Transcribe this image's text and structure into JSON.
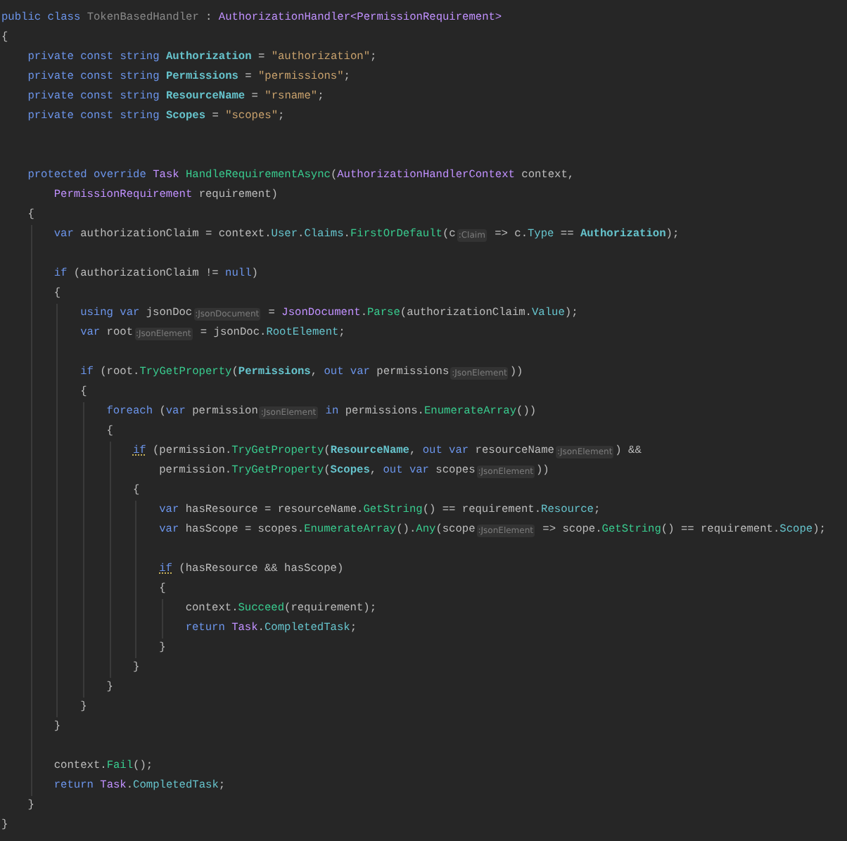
{
  "editor": {
    "lines": [
      {
        "kind": "code",
        "tokens": [
          {
            "kind": "kw",
            "text": "public class "
          },
          {
            "kind": "typedim",
            "text": "TokenBasedHandler"
          },
          {
            "kind": "plain",
            "text": " : "
          },
          {
            "kind": "type",
            "text": "AuthorizationHandler<PermissionRequirement>"
          }
        ]
      },
      {
        "kind": "code",
        "tokens": [
          {
            "kind": "plain",
            "text": "{"
          }
        ]
      },
      {
        "kind": "block",
        "guide": false,
        "children": [
          {
            "kind": "code",
            "tokens": [
              {
                "kind": "kw",
                "text": "private const string "
              },
              {
                "kind": "const",
                "text": "Authorization"
              },
              {
                "kind": "plain",
                "text": " = "
              },
              {
                "kind": "str",
                "text": "\"authorization\""
              },
              {
                "kind": "plain",
                "text": ";"
              }
            ]
          },
          {
            "kind": "code",
            "tokens": [
              {
                "kind": "kw",
                "text": "private const string "
              },
              {
                "kind": "const",
                "text": "Permissions"
              },
              {
                "kind": "plain",
                "text": " = "
              },
              {
                "kind": "str",
                "text": "\"permissions\""
              },
              {
                "kind": "plain",
                "text": ";"
              }
            ]
          },
          {
            "kind": "code",
            "tokens": [
              {
                "kind": "kw",
                "text": "private const string "
              },
              {
                "kind": "const",
                "text": "ResourceName"
              },
              {
                "kind": "plain",
                "text": " = "
              },
              {
                "kind": "str",
                "text": "\"rsname\""
              },
              {
                "kind": "plain",
                "text": ";"
              }
            ]
          },
          {
            "kind": "code",
            "tokens": [
              {
                "kind": "kw",
                "text": "private const string "
              },
              {
                "kind": "const",
                "text": "Scopes"
              },
              {
                "kind": "plain",
                "text": " = "
              },
              {
                "kind": "str",
                "text": "\"scopes\""
              },
              {
                "kind": "plain",
                "text": ";"
              }
            ]
          },
          {
            "kind": "blank"
          },
          {
            "kind": "blank"
          },
          {
            "kind": "code",
            "tokens": [
              {
                "kind": "kw",
                "text": "protected override "
              },
              {
                "kind": "type",
                "text": "Task"
              },
              {
                "kind": "method",
                "text": " HandleRequirementAsync"
              },
              {
                "kind": "plain",
                "text": "("
              },
              {
                "kind": "type",
                "text": "AuthorizationHandlerContext"
              },
              {
                "kind": "plain",
                "text": " context,"
              }
            ]
          },
          {
            "kind": "continuation",
            "tokens": [
              {
                "kind": "type",
                "text": "PermissionRequirement"
              },
              {
                "kind": "plain",
                "text": " requirement)"
              }
            ]
          },
          {
            "kind": "code",
            "tokens": [
              {
                "kind": "plain",
                "text": "{"
              }
            ]
          },
          {
            "kind": "block",
            "guide": true,
            "children": [
              {
                "kind": "code",
                "tokens": [
                  {
                    "kind": "kw",
                    "text": "var "
                  },
                  {
                    "kind": "plain",
                    "text": "authorizationClaim = context."
                  },
                  {
                    "kind": "prop",
                    "text": "User"
                  },
                  {
                    "kind": "plain",
                    "text": "."
                  },
                  {
                    "kind": "prop",
                    "text": "Claims"
                  },
                  {
                    "kind": "plain",
                    "text": "."
                  },
                  {
                    "kind": "method",
                    "text": "FirstOrDefault"
                  },
                  {
                    "kind": "plain",
                    "text": "(c"
                  },
                  {
                    "kind": "hint",
                    "text": ":Claim"
                  },
                  {
                    "kind": "plain",
                    "text": " => c."
                  },
                  {
                    "kind": "prop",
                    "text": "Type"
                  },
                  {
                    "kind": "plain",
                    "text": " == "
                  },
                  {
                    "kind": "const",
                    "text": "Authorization"
                  },
                  {
                    "kind": "plain",
                    "text": ");"
                  }
                ]
              },
              {
                "kind": "blank"
              },
              {
                "kind": "code",
                "tokens": [
                  {
                    "kind": "kw",
                    "text": "if "
                  },
                  {
                    "kind": "plain",
                    "text": "(authorizationClaim != "
                  },
                  {
                    "kind": "kw",
                    "text": "null"
                  },
                  {
                    "kind": "plain",
                    "text": ")"
                  }
                ]
              },
              {
                "kind": "code",
                "tokens": [
                  {
                    "kind": "plain",
                    "text": "{"
                  }
                ]
              },
              {
                "kind": "block",
                "guide": true,
                "children": [
                  {
                    "kind": "code",
                    "tokens": [
                      {
                        "kind": "kw",
                        "text": "using var "
                      },
                      {
                        "kind": "plain",
                        "text": "jsonDoc"
                      },
                      {
                        "kind": "hint",
                        "text": ":JsonDocument"
                      },
                      {
                        "kind": "plain",
                        "text": " = "
                      },
                      {
                        "kind": "type",
                        "text": "JsonDocument"
                      },
                      {
                        "kind": "plain",
                        "text": "."
                      },
                      {
                        "kind": "method",
                        "text": "Parse"
                      },
                      {
                        "kind": "plain",
                        "text": "(authorizationClaim."
                      },
                      {
                        "kind": "prop",
                        "text": "Value"
                      },
                      {
                        "kind": "plain",
                        "text": ");"
                      }
                    ]
                  },
                  {
                    "kind": "code",
                    "tokens": [
                      {
                        "kind": "kw",
                        "text": "var "
                      },
                      {
                        "kind": "plain",
                        "text": "root"
                      },
                      {
                        "kind": "hint",
                        "text": ":JsonElement"
                      },
                      {
                        "kind": "plain",
                        "text": " = jsonDoc."
                      },
                      {
                        "kind": "prop",
                        "text": "RootElement"
                      },
                      {
                        "kind": "plain",
                        "text": ";"
                      }
                    ]
                  },
                  {
                    "kind": "blank"
                  },
                  {
                    "kind": "code",
                    "tokens": [
                      {
                        "kind": "kw",
                        "text": "if "
                      },
                      {
                        "kind": "plain",
                        "text": "(root."
                      },
                      {
                        "kind": "method",
                        "text": "TryGetProperty"
                      },
                      {
                        "kind": "plain",
                        "text": "("
                      },
                      {
                        "kind": "const",
                        "text": "Permissions"
                      },
                      {
                        "kind": "plain",
                        "text": ", "
                      },
                      {
                        "kind": "kw",
                        "text": "out var "
                      },
                      {
                        "kind": "plain",
                        "text": "permissions"
                      },
                      {
                        "kind": "hint",
                        "text": ":JsonElement"
                      },
                      {
                        "kind": "plain",
                        "text": "))"
                      }
                    ]
                  },
                  {
                    "kind": "code",
                    "tokens": [
                      {
                        "kind": "plain",
                        "text": "{"
                      }
                    ]
                  },
                  {
                    "kind": "block",
                    "guide": true,
                    "children": [
                      {
                        "kind": "code",
                        "tokens": [
                          {
                            "kind": "kw",
                            "text": "foreach "
                          },
                          {
                            "kind": "plain",
                            "text": "("
                          },
                          {
                            "kind": "kw",
                            "text": "var "
                          },
                          {
                            "kind": "plain",
                            "text": "permission"
                          },
                          {
                            "kind": "hint",
                            "text": ":JsonElement"
                          },
                          {
                            "kind": "kw",
                            "text": " in "
                          },
                          {
                            "kind": "plain",
                            "text": "permissions."
                          },
                          {
                            "kind": "method",
                            "text": "EnumerateArray"
                          },
                          {
                            "kind": "plain",
                            "text": "())"
                          }
                        ]
                      },
                      {
                        "kind": "code",
                        "tokens": [
                          {
                            "kind": "plain",
                            "text": "{"
                          }
                        ]
                      },
                      {
                        "kind": "block",
                        "guide": true,
                        "children": [
                          {
                            "kind": "code",
                            "tokens": [
                              {
                                "kind": "kwflag",
                                "text": "if"
                              },
                              {
                                "kind": "plain",
                                "text": " (permission."
                              },
                              {
                                "kind": "method",
                                "text": "TryGetProperty"
                              },
                              {
                                "kind": "plain",
                                "text": "("
                              },
                              {
                                "kind": "const",
                                "text": "ResourceName"
                              },
                              {
                                "kind": "plain",
                                "text": ", "
                              },
                              {
                                "kind": "kw",
                                "text": "out var "
                              },
                              {
                                "kind": "plain",
                                "text": "resourceName"
                              },
                              {
                                "kind": "hint",
                                "text": ":JsonElement"
                              },
                              {
                                "kind": "plain",
                                "text": ") &&"
                              }
                            ]
                          },
                          {
                            "kind": "continuation",
                            "tokens": [
                              {
                                "kind": "plain",
                                "text": "permission."
                              },
                              {
                                "kind": "method",
                                "text": "TryGetProperty"
                              },
                              {
                                "kind": "plain",
                                "text": "("
                              },
                              {
                                "kind": "const",
                                "text": "Scopes"
                              },
                              {
                                "kind": "plain",
                                "text": ", "
                              },
                              {
                                "kind": "kw",
                                "text": "out var "
                              },
                              {
                                "kind": "plain",
                                "text": "scopes"
                              },
                              {
                                "kind": "hint",
                                "text": ":JsonElement"
                              },
                              {
                                "kind": "plain",
                                "text": "))"
                              }
                            ]
                          },
                          {
                            "kind": "code",
                            "tokens": [
                              {
                                "kind": "plain",
                                "text": "{"
                              }
                            ]
                          },
                          {
                            "kind": "block",
                            "guide": true,
                            "children": [
                              {
                                "kind": "code",
                                "tokens": [
                                  {
                                    "kind": "kw",
                                    "text": "var "
                                  },
                                  {
                                    "kind": "plain",
                                    "text": "hasResource = resourceName."
                                  },
                                  {
                                    "kind": "method",
                                    "text": "GetString"
                                  },
                                  {
                                    "kind": "plain",
                                    "text": "() == requirement."
                                  },
                                  {
                                    "kind": "prop",
                                    "text": "Resource"
                                  },
                                  {
                                    "kind": "plain",
                                    "text": ";"
                                  }
                                ]
                              },
                              {
                                "kind": "code",
                                "tokens": [
                                  {
                                    "kind": "kw",
                                    "text": "var "
                                  },
                                  {
                                    "kind": "plain",
                                    "text": "hasScope = scopes."
                                  },
                                  {
                                    "kind": "method",
                                    "text": "EnumerateArray"
                                  },
                                  {
                                    "kind": "plain",
                                    "text": "()."
                                  },
                                  {
                                    "kind": "method",
                                    "text": "Any"
                                  },
                                  {
                                    "kind": "plain",
                                    "text": "(scope"
                                  },
                                  {
                                    "kind": "hint",
                                    "text": ":JsonElement"
                                  },
                                  {
                                    "kind": "plain",
                                    "text": " => scope."
                                  },
                                  {
                                    "kind": "method",
                                    "text": "GetString"
                                  },
                                  {
                                    "kind": "plain",
                                    "text": "() == requirement."
                                  },
                                  {
                                    "kind": "prop",
                                    "text": "Scope"
                                  },
                                  {
                                    "kind": "plain",
                                    "text": ");"
                                  }
                                ]
                              },
                              {
                                "kind": "blank"
                              },
                              {
                                "kind": "code",
                                "tokens": [
                                  {
                                    "kind": "kwflag",
                                    "text": "if"
                                  },
                                  {
                                    "kind": "plain",
                                    "text": " (hasResource && hasScope)"
                                  }
                                ]
                              },
                              {
                                "kind": "code",
                                "tokens": [
                                  {
                                    "kind": "plain",
                                    "text": "{"
                                  }
                                ]
                              },
                              {
                                "kind": "block",
                                "guide": true,
                                "children": [
                                  {
                                    "kind": "code",
                                    "tokens": [
                                      {
                                        "kind": "plain",
                                        "text": "context."
                                      },
                                      {
                                        "kind": "method",
                                        "text": "Succeed"
                                      },
                                      {
                                        "kind": "plain",
                                        "text": "(requirement);"
                                      }
                                    ]
                                  },
                                  {
                                    "kind": "code",
                                    "tokens": [
                                      {
                                        "kind": "kw",
                                        "text": "return "
                                      },
                                      {
                                        "kind": "type",
                                        "text": "Task"
                                      },
                                      {
                                        "kind": "plain",
                                        "text": "."
                                      },
                                      {
                                        "kind": "prop",
                                        "text": "CompletedTask"
                                      },
                                      {
                                        "kind": "plain",
                                        "text": ";"
                                      }
                                    ]
                                  }
                                ]
                              },
                              {
                                "kind": "code",
                                "tokens": [
                                  {
                                    "kind": "plain",
                                    "text": "}"
                                  }
                                ]
                              }
                            ]
                          },
                          {
                            "kind": "code",
                            "tokens": [
                              {
                                "kind": "plain",
                                "text": "}"
                              }
                            ]
                          }
                        ]
                      },
                      {
                        "kind": "code",
                        "tokens": [
                          {
                            "kind": "plain",
                            "text": "}"
                          }
                        ]
                      }
                    ]
                  },
                  {
                    "kind": "code",
                    "tokens": [
                      {
                        "kind": "plain",
                        "text": "}"
                      }
                    ]
                  }
                ]
              },
              {
                "kind": "code",
                "tokens": [
                  {
                    "kind": "plain",
                    "text": "}"
                  }
                ]
              },
              {
                "kind": "blank"
              },
              {
                "kind": "code",
                "tokens": [
                  {
                    "kind": "plain",
                    "text": "context."
                  },
                  {
                    "kind": "method",
                    "text": "Fail"
                  },
                  {
                    "kind": "plain",
                    "text": "();"
                  }
                ]
              },
              {
                "kind": "code",
                "tokens": [
                  {
                    "kind": "kw",
                    "text": "return "
                  },
                  {
                    "kind": "type",
                    "text": "Task"
                  },
                  {
                    "kind": "plain",
                    "text": "."
                  },
                  {
                    "kind": "prop",
                    "text": "CompletedTask"
                  },
                  {
                    "kind": "plain",
                    "text": ";"
                  }
                ]
              }
            ]
          },
          {
            "kind": "code",
            "tokens": [
              {
                "kind": "plain",
                "text": "}"
              }
            ]
          }
        ]
      },
      {
        "kind": "code",
        "tokens": [
          {
            "kind": "plain",
            "text": "}"
          }
        ]
      }
    ]
  }
}
